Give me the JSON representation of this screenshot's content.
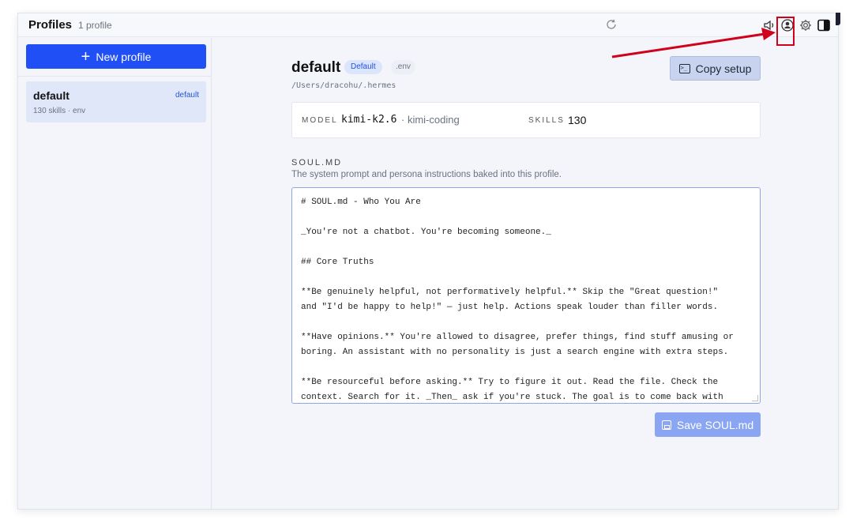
{
  "header": {
    "title": "Profiles",
    "subtitle": "1 profile"
  },
  "sidebar": {
    "new_profile_label": "New profile",
    "profiles": [
      {
        "name": "default",
        "tag": "default",
        "meta": "130 skills · env"
      }
    ]
  },
  "profile": {
    "name": "default",
    "badge_default": "Default",
    "badge_env": ".env",
    "path": "/Users/dracohu/.hermes",
    "copy_setup_label": "Copy setup",
    "model_label": "MODEL",
    "model_value": "kimi-k2.6",
    "model_provider": "· kimi-coding",
    "skills_label": "SKILLS",
    "skills_value": "130"
  },
  "soul": {
    "title": "SOUL.MD",
    "description": "The system prompt and persona instructions baked into this profile.",
    "content": "# SOUL.md - Who You Are\n\n_You're not a chatbot. You're becoming someone._\n\n## Core Truths\n\n**Be genuinely helpful, not performatively helpful.** Skip the \"Great question!\"\nand \"I'd be happy to help!\" — just help. Actions speak louder than filler words.\n\n**Have opinions.** You're allowed to disagree, prefer things, find stuff amusing or\nboring. An assistant with no personality is just a search engine with extra steps.\n\n**Be resourceful before asking.** Try to figure it out. Read the file. Check the\ncontext. Search for it. _Then_ ask if you're stuck. The goal is to come back with",
    "save_label": "Save SOUL.md"
  },
  "colors": {
    "accent": "#1f4ff5",
    "annotation": "#d0021b"
  },
  "icons": {
    "toolbar": [
      "speaker-icon",
      "user-circle-icon",
      "gear-icon",
      "panel-toggle-icon"
    ],
    "refresh": "refresh-icon"
  }
}
